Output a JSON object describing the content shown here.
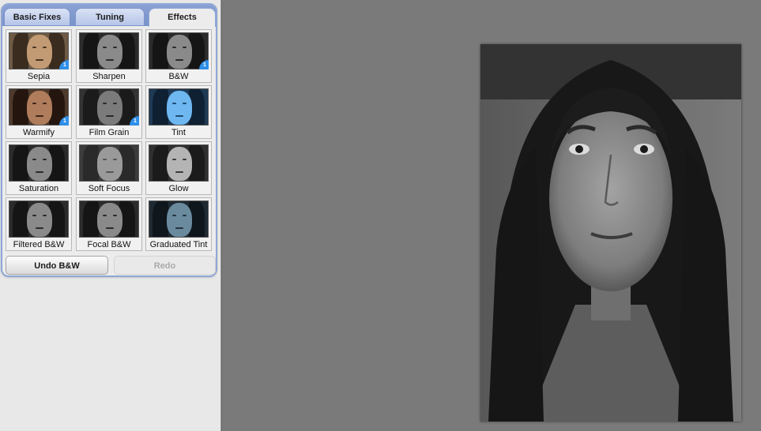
{
  "tabs": [
    {
      "label": "Basic Fixes",
      "active": false
    },
    {
      "label": "Tuning",
      "active": false
    },
    {
      "label": "Effects",
      "active": true
    }
  ],
  "effects": [
    {
      "label": "Sepia",
      "name": "effect-sepia",
      "badge": "1",
      "style": "sepia"
    },
    {
      "label": "Sharpen",
      "name": "effect-sharpen",
      "badge": null,
      "style": "bw"
    },
    {
      "label": "B&W",
      "name": "effect-bw",
      "badge": "1",
      "style": "bw"
    },
    {
      "label": "Warmify",
      "name": "effect-warmify",
      "badge": "1",
      "style": "warm"
    },
    {
      "label": "Film Grain",
      "name": "effect-film-grain",
      "badge": "1",
      "style": "grain"
    },
    {
      "label": "Tint",
      "name": "effect-tint",
      "badge": null,
      "style": "tint"
    },
    {
      "label": "Saturation",
      "name": "effect-saturation",
      "badge": null,
      "style": "bw"
    },
    {
      "label": "Soft Focus",
      "name": "effect-soft-focus",
      "badge": null,
      "style": "soft"
    },
    {
      "label": "Glow",
      "name": "effect-glow",
      "badge": null,
      "style": "glow"
    },
    {
      "label": "Filtered B&W",
      "name": "effect-filtered-bw",
      "badge": null,
      "style": "bw"
    },
    {
      "label": "Focal B&W",
      "name": "effect-focal-bw",
      "badge": null,
      "style": "bw"
    },
    {
      "label": "Graduated Tint",
      "name": "effect-graduated-tint",
      "badge": null,
      "style": "gradtint"
    }
  ],
  "buttons": {
    "undo_label": "Undo B&W",
    "redo_label": "Redo",
    "redo_enabled": false
  },
  "colors": {
    "tab_accent": "#8ea6d6",
    "badge": "#2f8fe8",
    "canvas_bg": "#7a7a7a"
  }
}
